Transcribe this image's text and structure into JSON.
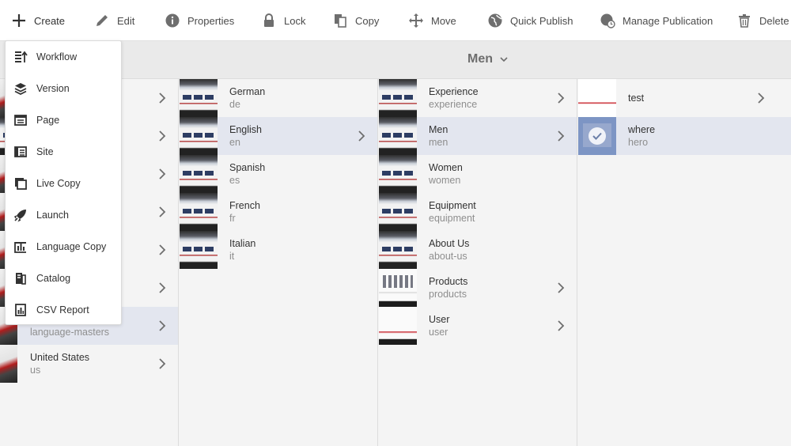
{
  "toolbar": {
    "create": "Create",
    "edit": "Edit",
    "properties": "Properties",
    "lock": "Lock",
    "copy": "Copy",
    "move": "Move",
    "quick_publish": "Quick Publish",
    "manage_publication": "Manage Publication",
    "delete": "Delete"
  },
  "header": {
    "title": "Men"
  },
  "create_menu": {
    "items": [
      {
        "label": "Workflow",
        "icon": "workflow-icon"
      },
      {
        "label": "Version",
        "icon": "version-icon"
      },
      {
        "label": "Page",
        "icon": "page-icon"
      },
      {
        "label": "Site",
        "icon": "site-icon"
      },
      {
        "label": "Live Copy",
        "icon": "live-copy-icon"
      },
      {
        "label": "Launch",
        "icon": "launch-icon"
      },
      {
        "label": "Language Copy",
        "icon": "language-copy-icon"
      },
      {
        "label": "Catalog",
        "icon": "catalog-icon"
      },
      {
        "label": "CSV Report",
        "icon": "csv-report-icon"
      }
    ]
  },
  "columns": {
    "col0": {
      "rows": [
        {
          "title": "",
          "name": ""
        },
        {
          "title": "",
          "name": ""
        },
        {
          "title": "",
          "name": ""
        },
        {
          "title": "",
          "name": ""
        },
        {
          "title": "",
          "name": ""
        },
        {
          "title": "",
          "name": ""
        },
        {
          "title": "",
          "name": "language-masters"
        },
        {
          "title": "United States",
          "name": "us"
        }
      ]
    },
    "col1": {
      "rows": [
        {
          "title": "German",
          "name": "de"
        },
        {
          "title": "English",
          "name": "en"
        },
        {
          "title": "Spanish",
          "name": "es"
        },
        {
          "title": "French",
          "name": "fr"
        },
        {
          "title": "Italian",
          "name": "it"
        }
      ]
    },
    "col2": {
      "rows": [
        {
          "title": "Experience",
          "name": "experience"
        },
        {
          "title": "Men",
          "name": "men"
        },
        {
          "title": "Women",
          "name": "women"
        },
        {
          "title": "Equipment",
          "name": "equipment"
        },
        {
          "title": "About Us",
          "name": "about-us"
        },
        {
          "title": "Products",
          "name": "products"
        },
        {
          "title": "User",
          "name": "user"
        }
      ]
    },
    "col3": {
      "rows": [
        {
          "title": "test",
          "name": ""
        },
        {
          "title": "where",
          "name": "hero"
        }
      ]
    }
  },
  "colors": {
    "selected_row": "#e3e6ef",
    "toolbar_bg": "#ffffff",
    "title_bar_bg": "#eaeaea",
    "column_bg": "#f4f4f4"
  }
}
